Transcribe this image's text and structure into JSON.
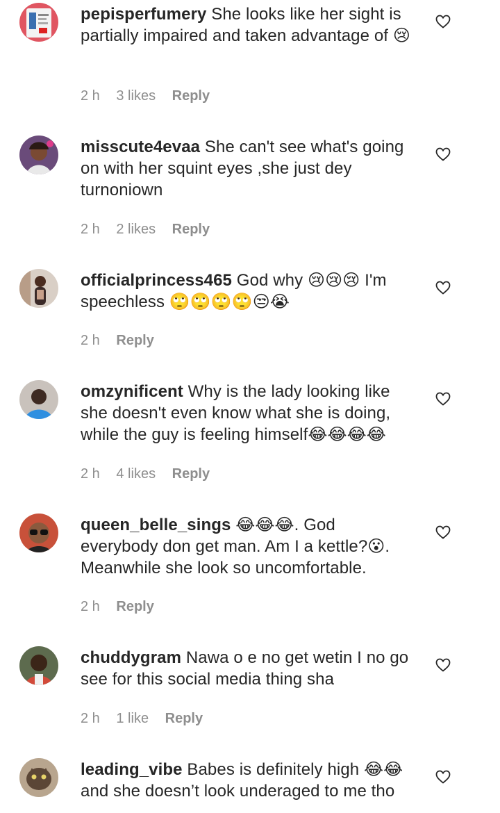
{
  "comments": [
    {
      "username": "pepisperfumery",
      "text": "She looks like her sight is partially impaired and taken advantage of 😢",
      "time": "2 h",
      "likes": "3 likes",
      "reply": "Reply"
    },
    {
      "username": "misscute4evaa",
      "text": "She can't see what's going on with her squint eyes ,she just dey turnoniown",
      "time": "2 h",
      "likes": "2 likes",
      "reply": "Reply"
    },
    {
      "username": "officialprincess465",
      "text": "God why 😢😢😢 I'm speechless 🙄🙄🙄🙄😒😭",
      "time": "2 h",
      "likes": "",
      "reply": "Reply"
    },
    {
      "username": "omzynificent",
      "text": "Why is the lady looking like she doesn't even know what she is doing, while the guy is feeling himself😂😂😂😂",
      "time": "2 h",
      "likes": "4 likes",
      "reply": "Reply"
    },
    {
      "username": "queen_belle_sings",
      "text": "😂😂😂. God everybody don get man. Am I a kettle?😮. Meanwhile she look so uncomfortable.",
      "time": "2 h",
      "likes": "",
      "reply": "Reply"
    },
    {
      "username": "chuddygram",
      "text": "Nawa o e no get wetin I no go see for this social media thing sha",
      "time": "2 h",
      "likes": "1 like",
      "reply": "Reply"
    },
    {
      "username": "leading_vibe",
      "text": "Babes is definitely high 😂😂 and she doesn’t look underaged to me tho",
      "time": "",
      "likes": "",
      "reply": ""
    }
  ],
  "icons": {
    "like": "heart-outline-icon",
    "avatar": "avatar"
  },
  "colors": {
    "text": "#262626",
    "meta": "#8e8e8e"
  }
}
